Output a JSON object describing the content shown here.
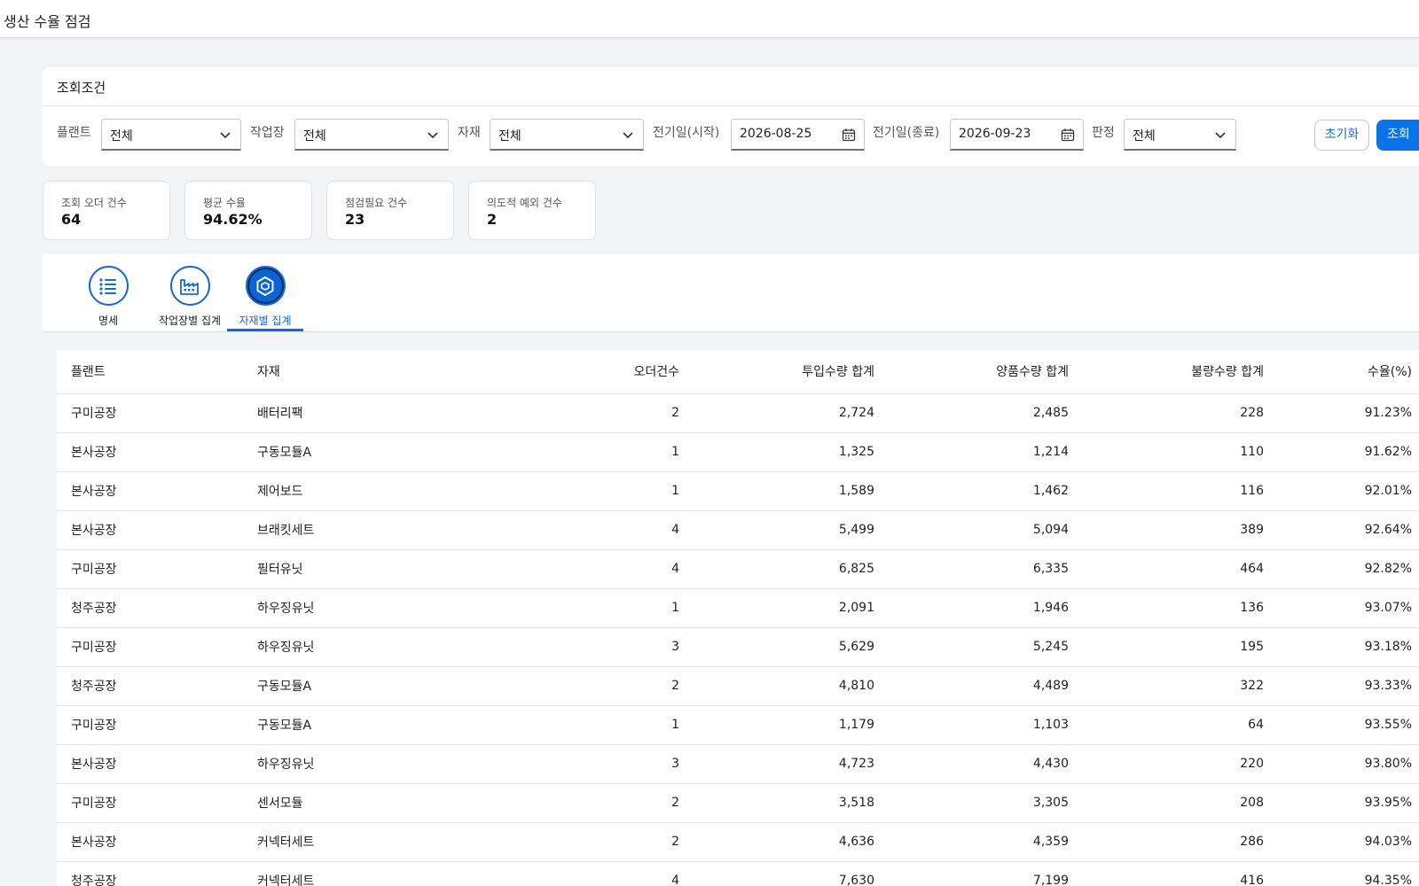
{
  "app": {
    "title": "생산 수율 점검"
  },
  "search": {
    "title": "조회조건",
    "filters": {
      "plant": {
        "label": "플랜트",
        "value": "전체"
      },
      "workcenter": {
        "label": "작업장",
        "value": "전체"
      },
      "material": {
        "label": "자재",
        "value": "전체"
      },
      "date_from": {
        "label": "전기일(시작)",
        "value": "2026-08-25"
      },
      "date_to": {
        "label": "전기일(종료)",
        "value": "2026-09-23"
      },
      "judgment": {
        "label": "판정",
        "value": "전체"
      }
    },
    "reset_label": "초기화",
    "search_label": "조회"
  },
  "kpis": [
    {
      "label": "조회 오더 건수",
      "value": "64"
    },
    {
      "label": "평균 수율",
      "value": "94.62%"
    },
    {
      "label": "점검필요 건수",
      "value": "23"
    },
    {
      "label": "의도적 예외 건수",
      "value": "2"
    }
  ],
  "tabs": [
    {
      "label": "명세",
      "icon": "list-icon",
      "active": false
    },
    {
      "label": "작업장별 집계",
      "icon": "factory-icon",
      "active": false
    },
    {
      "label": "자재별 집계",
      "icon": "material-hex-icon",
      "active": true
    }
  ],
  "table": {
    "columns": [
      "플랜트",
      "자재",
      "오더건수",
      "투입수량 합계",
      "양품수량 합계",
      "불량수량 합계",
      "수율(%)"
    ],
    "rows": [
      [
        "구미공장",
        "배터리팩",
        "2",
        "2,724",
        "2,485",
        "228",
        "91.23%"
      ],
      [
        "본사공장",
        "구동모듈A",
        "1",
        "1,325",
        "1,214",
        "110",
        "91.62%"
      ],
      [
        "본사공장",
        "제어보드",
        "1",
        "1,589",
        "1,462",
        "116",
        "92.01%"
      ],
      [
        "본사공장",
        "브래킷세트",
        "4",
        "5,499",
        "5,094",
        "389",
        "92.64%"
      ],
      [
        "구미공장",
        "필터유닛",
        "4",
        "6,825",
        "6,335",
        "464",
        "92.82%"
      ],
      [
        "청주공장",
        "하우징유닛",
        "1",
        "2,091",
        "1,946",
        "136",
        "93.07%"
      ],
      [
        "구미공장",
        "하우징유닛",
        "3",
        "5,629",
        "5,245",
        "195",
        "93.18%"
      ],
      [
        "청주공장",
        "구동모듈A",
        "2",
        "4,810",
        "4,489",
        "322",
        "93.33%"
      ],
      [
        "구미공장",
        "구동모듈A",
        "1",
        "1,179",
        "1,103",
        "64",
        "93.55%"
      ],
      [
        "본사공장",
        "하우징유닛",
        "3",
        "4,723",
        "4,430",
        "220",
        "93.80%"
      ],
      [
        "구미공장",
        "센서모듈",
        "2",
        "3,518",
        "3,305",
        "208",
        "93.95%"
      ],
      [
        "본사공장",
        "커넥터세트",
        "2",
        "4,636",
        "4,359",
        "286",
        "94.03%"
      ],
      [
        "청주공장",
        "커넥터세트",
        "4",
        "7,630",
        "7,199",
        "416",
        "94.35%"
      ]
    ]
  },
  "colors": {
    "accent": "#1769d6",
    "primary_button": "#0b72e7",
    "background": "#f2f3f5"
  }
}
